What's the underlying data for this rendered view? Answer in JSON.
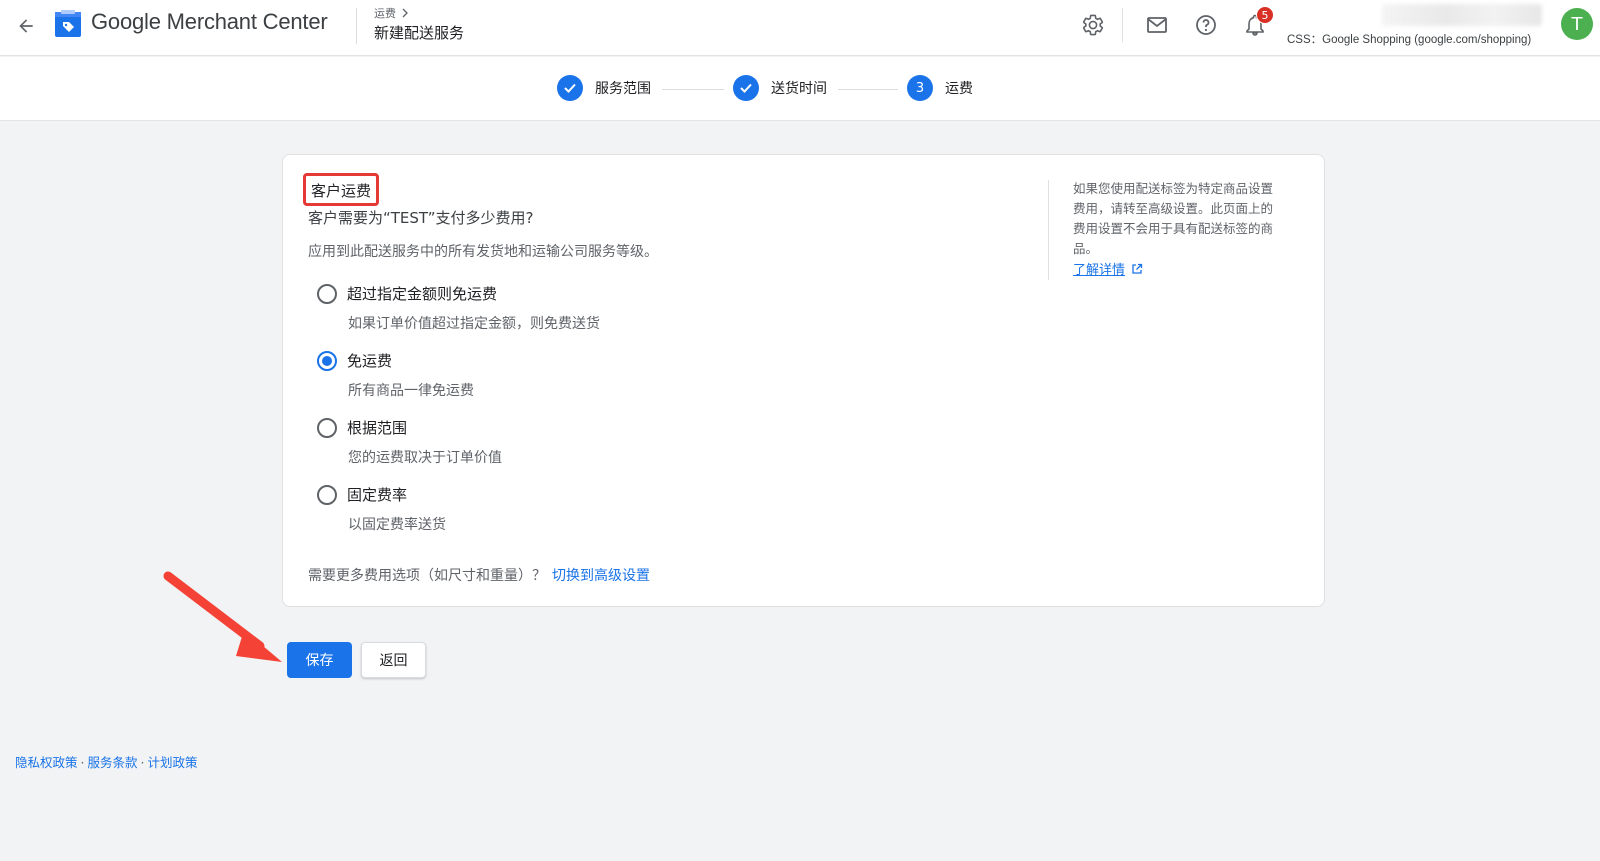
{
  "header": {
    "app_title": "Google Merchant Center",
    "breadcrumb_parent": "运费",
    "page_title": "新建配送服务",
    "notification_count": "5",
    "css_label": "CSS：Google Shopping (google.com/shopping)",
    "avatar_letter": "T",
    "icons": [
      "back-arrow-icon",
      "gear-icon",
      "mail-icon",
      "help-icon",
      "bell-icon"
    ]
  },
  "stepper": {
    "steps": [
      {
        "label": "服务范围",
        "status": "done"
      },
      {
        "label": "送货时间",
        "status": "done"
      },
      {
        "label": "运费",
        "status": "current",
        "number": "3"
      }
    ]
  },
  "card": {
    "section_title": "客户运费",
    "question": "客户需要为“TEST”支付多少费用?",
    "subtext": "应用到此配送服务中的所有发货地和运输公司服务等级。",
    "options": [
      {
        "label": "超过指定金额则免运费",
        "desc": "如果订单价值超过指定金额，则免费送货",
        "checked": false
      },
      {
        "label": "免运费",
        "desc": "所有商品一律免运费",
        "checked": true
      },
      {
        "label": "根据范围",
        "desc": "您的运费取决于订单价值",
        "checked": false
      },
      {
        "label": "固定费率",
        "desc": "以固定费率送货",
        "checked": false
      }
    ],
    "more_options_text": "需要更多费用选项（如尺寸和重量）？",
    "more_options_link": "切换到高级设置",
    "side_info": "如果您使用配送标签为特定商品设置费用，请转至高级设置。此页面上的费用设置不会用于具有配送标签的商品。",
    "side_link": "了解详情"
  },
  "buttons": {
    "save": "保存",
    "back": "返回"
  },
  "footer": {
    "privacy": "隐私权政策",
    "terms": "服务条款",
    "program": "计划政策",
    "separator": "·"
  },
  "colors": {
    "primary": "#1a73e8",
    "highlight": "#e53935",
    "badge": "#d93025",
    "avatar": "#4caf50"
  }
}
